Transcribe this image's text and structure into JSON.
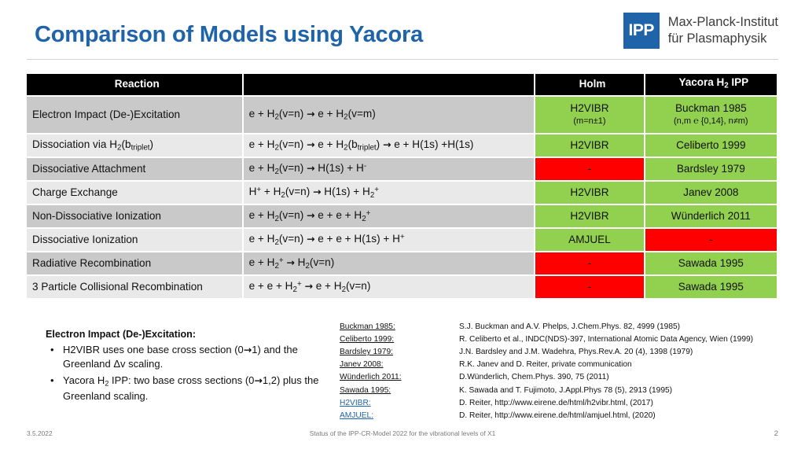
{
  "slide": {
    "title": "Comparison of Models using Yacora",
    "logo": {
      "mark": "IPP",
      "line1": "Max-Planck-Institut",
      "line2": "für Plasmaphysik"
    },
    "brand_color": "#1F63A8"
  },
  "table": {
    "headers": [
      "Reaction",
      "",
      "Holm",
      "Yacora H₂ IPP"
    ],
    "colors": {
      "available": "#92D050",
      "missing": "#FF0000",
      "header_bg": "#000000",
      "row_dark": "#c9c9c9",
      "row_light": "#e9e9e9"
    },
    "rows": [
      {
        "reaction": "Electron Impact (De-)Excitation",
        "equation_html": "e + H<sub>2</sub>(v=n) <span class=\"arr\">→</span> e + H<sub>2</sub>(v=m)",
        "holm": "H2VIBR",
        "holm_note": "(m=n±1)",
        "holm_state": "available",
        "yacora": "Buckman 1985",
        "yacora_note": "(n,m ℮ {0,14}, n≠m)",
        "yacora_state": "available"
      },
      {
        "reaction_html": "Dissociation via H<sub>2</sub>(b<sub>triplet</sub>)",
        "reaction": "Dissociation via H2(btriplet)",
        "equation_html": "e + H<sub>2</sub>(v=n) <span class=\"arr\">→</span> e + H<sub>2</sub>(b<sub>triplet</sub>) <span class=\"arr\">→</span> e + H(1s) +H(1s)",
        "holm": "H2VIBR",
        "holm_note": "",
        "holm_state": "available",
        "yacora": "Celiberto 1999",
        "yacora_note": "",
        "yacora_state": "available"
      },
      {
        "reaction": "Dissociative Attachment",
        "equation_html": "e + H<sub>2</sub>(v=n) <span class=\"arr\">→</span> H(1s) + H<sup>-</sup>",
        "holm": "-",
        "holm_note": "",
        "holm_state": "missing",
        "yacora": "Bardsley 1979",
        "yacora_note": "",
        "yacora_state": "available"
      },
      {
        "reaction": "Charge Exchange",
        "equation_html": "H<sup>+</sup> + H<sub>2</sub>(v=n) <span class=\"arr\">→</span> H(1s) + H<sub>2</sub><sup>+</sup>",
        "holm": "H2VIBR",
        "holm_note": "",
        "holm_state": "available",
        "yacora": "Janev 2008",
        "yacora_note": "",
        "yacora_state": "available"
      },
      {
        "reaction": "Non-Dissociative Ionization",
        "equation_html": "e + H<sub>2</sub>(v=n) <span class=\"arr\">→</span> e + e + H<sub>2</sub><sup>+</sup>",
        "holm": "H2VIBR",
        "holm_note": "",
        "holm_state": "available",
        "yacora": "Wünderlich 2011",
        "yacora_note": "",
        "yacora_state": "available"
      },
      {
        "reaction": "Dissociative Ionization",
        "equation_html": "e + H<sub>2</sub>(v=n) <span class=\"arr\">→</span> e + e + H(1s) + H<sup>+</sup>",
        "holm": "AMJUEL",
        "holm_note": "",
        "holm_state": "available",
        "yacora": "-",
        "yacora_note": "",
        "yacora_state": "missing"
      },
      {
        "reaction": "Radiative Recombination",
        "equation_html": "e + H<sub>2</sub><sup>+</sup> <span class=\"arr\">→</span> H<sub>2</sub>(v=n)",
        "holm": "-",
        "holm_note": "",
        "holm_state": "missing",
        "yacora": "Sawada 1995",
        "yacora_note": "",
        "yacora_state": "available"
      },
      {
        "reaction": "3 Particle Collisional Recombination",
        "equation_html": "e + e + H<sub>2</sub><sup>+</sup> <span class=\"arr\">→</span> e + H<sub>2</sub>(v=n)",
        "holm": "-",
        "holm_note": "",
        "holm_state": "missing",
        "yacora": "Sawada 1995",
        "yacora_note": "",
        "yacora_state": "available"
      }
    ]
  },
  "notes": {
    "title": "Electron Impact (De-)Excitation:",
    "bullet_marker": "•",
    "bullets": [
      "H2VIBR uses one base cross section (0→1) and the Greenland Δv scaling.",
      "Yacora H2 IPP: two base cross sections (0→1,2) plus the Greenland scaling."
    ]
  },
  "references": [
    {
      "key": "Buckman 1985:",
      "value": "S.J. Buckman and A.V. Phelps, J.Chem.Phys. 82, 4999 (1985)",
      "link": false
    },
    {
      "key": "Celiberto 1999:",
      "value": "R. Celiberto et al., INDC(NDS)-397, International Atomic Data Agency, Wien (1999)",
      "link": false
    },
    {
      "key": "Bardsley 1979:",
      "value": "J.N. Bardsley and J.M. Wadehra, Phys.Rev.A. 20 (4), 1398 (1979)",
      "link": false
    },
    {
      "key": "Janev 2008:",
      "value": "R.K. Janev and D. Reiter, private communication",
      "link": false
    },
    {
      "key": "Wünderlich 2011:",
      "value": "D.Wünderlich, Chem.Phys. 390, 75 (2011)",
      "link": false
    },
    {
      "key": "Sawada 1995:",
      "value": "K. Sawada and T. Fujimoto, J.Appl.Phys 78 (5), 2913 (1995)",
      "link": false
    },
    {
      "key": "H2VIBR:",
      "value": "D. Reiter, http://www.eirene.de/html/h2vibr.html, (2017)",
      "link": true
    },
    {
      "key": "AMJUEL:",
      "value": "D. Reiter, http://www.eirene.de/html/amjuel.html, (2020)",
      "link": true
    }
  ],
  "footer": {
    "date": "3.5.2022",
    "center": "Status of the IPP-CR-Model 2022 for the vibrational levels of X1",
    "page": "2"
  }
}
